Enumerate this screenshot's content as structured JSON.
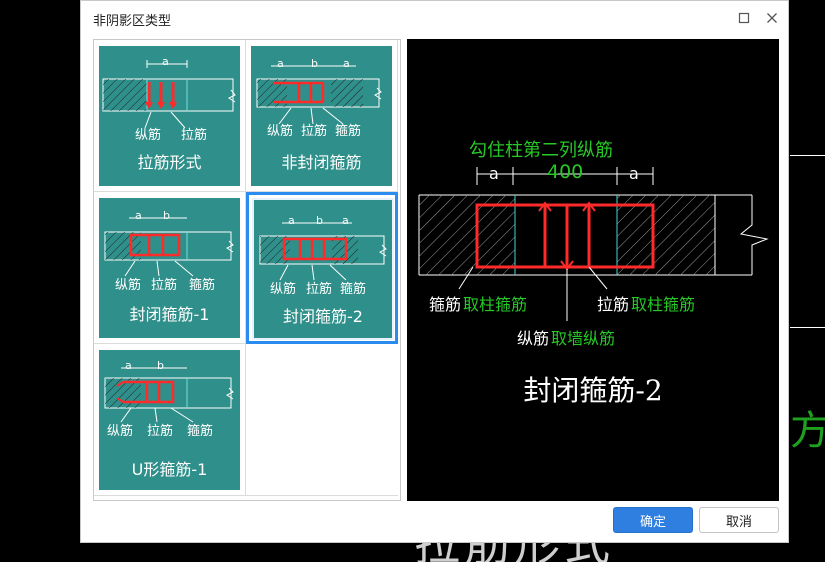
{
  "dialog": {
    "title": "非阴影区类型",
    "ok_label": "确定",
    "cancel_label": "取消"
  },
  "options": [
    {
      "name": "拉筋形式",
      "labels": [
        "纵筋",
        "拉筋"
      ],
      "dims": [
        "a"
      ]
    },
    {
      "name": "非封闭箍筋",
      "labels": [
        "纵筋",
        "拉筋",
        "箍筋"
      ],
      "dims": [
        "a",
        "b",
        "a"
      ]
    },
    {
      "name": "封闭箍筋-1",
      "labels": [
        "纵筋",
        "拉筋",
        "箍筋"
      ],
      "dims": [
        "a",
        "b"
      ]
    },
    {
      "name": "封闭箍筋-2",
      "labels": [
        "纵筋",
        "拉筋",
        "箍筋"
      ],
      "dims": [
        "a",
        "b",
        "a"
      ]
    },
    {
      "name": "U形箍筋-1",
      "labels": [
        "纵筋",
        "拉筋",
        "箍筋"
      ],
      "dims": [
        "a",
        "b"
      ]
    }
  ],
  "selected_index": 3,
  "preview": {
    "hook_label": "勾住柱第二列纵筋",
    "dim_a": "a",
    "dim_value": "400",
    "stirrup_label": "箍筋",
    "stirrup_source": "取柱箍筋",
    "tie_label": "拉筋",
    "tie_source": "取柱箍筋",
    "long_label": "纵筋",
    "long_source": "取墙纵筋",
    "title": "封闭箍筋-2"
  },
  "colors": {
    "tile": "#2f8f8a",
    "accent": "#2e7fe0",
    "rebar_red": "#ff2a2a",
    "cad_green": "#26c926"
  }
}
